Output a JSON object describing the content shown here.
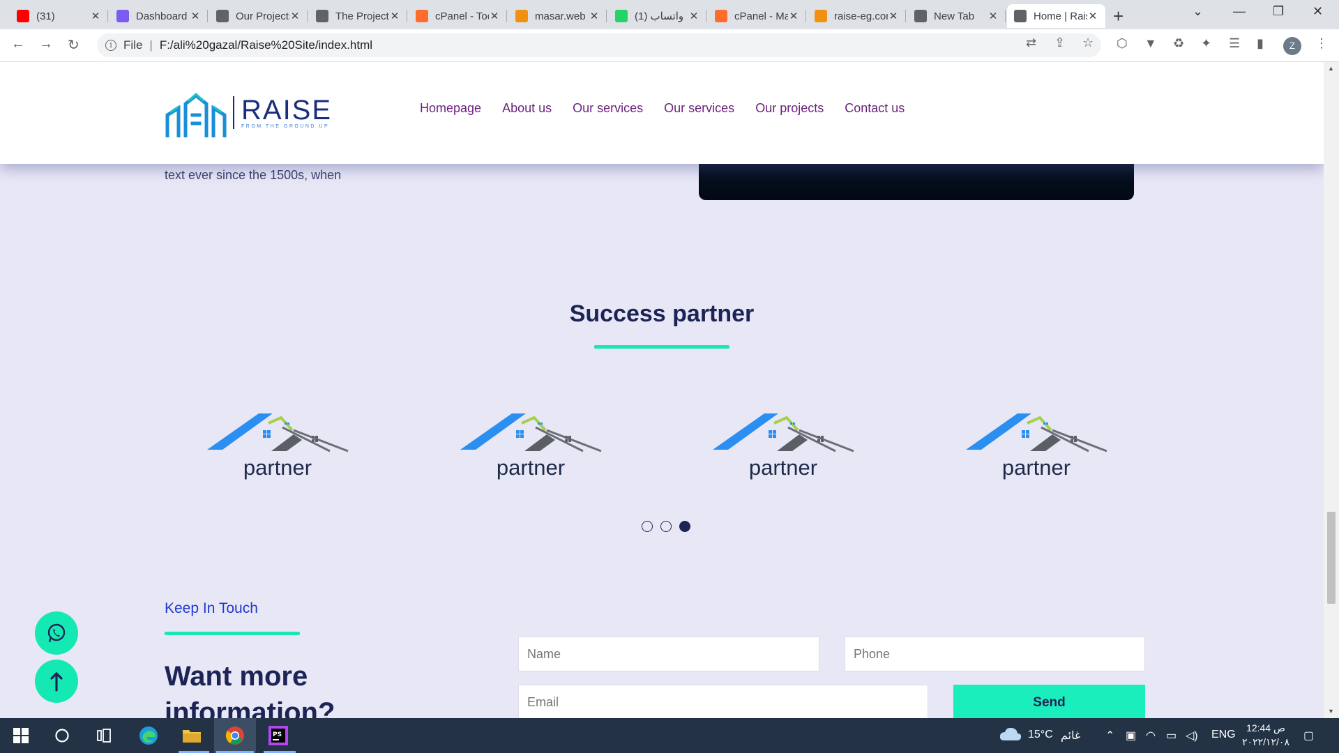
{
  "browser": {
    "tabs": [
      {
        "title": "(31)",
        "favicon": "youtube-icon",
        "color": "#ff0000"
      },
      {
        "title": "Dashboard",
        "favicon": "heart-logo-icon",
        "color": "#7b5cf0"
      },
      {
        "title": "Our Projects",
        "favicon": "globe-icon",
        "color": "#5f6368"
      },
      {
        "title": "The Projects",
        "favicon": "globe-icon",
        "color": "#5f6368"
      },
      {
        "title": "cPanel - Tools",
        "favicon": "cpanel-icon",
        "color": "#ff6c2c"
      },
      {
        "title": "masar.web",
        "favicon": "phpmyadmin-icon",
        "color": "#f29111"
      },
      {
        "title": "(1) واتساب",
        "favicon": "whatsapp-badge-icon",
        "color": "#25d366"
      },
      {
        "title": "cPanel - Main",
        "favicon": "cpanel-icon",
        "color": "#ff6c2c"
      },
      {
        "title": "raise-eg.com",
        "favicon": "phpmyadmin-icon",
        "color": "#f29111"
      },
      {
        "title": "New Tab",
        "favicon": "chrome-icon",
        "color": "#5f6368"
      },
      {
        "title": "Home | Raise",
        "favicon": "globe-icon",
        "color": "#5f6368",
        "active": true
      }
    ],
    "address": {
      "scheme": "File",
      "url": "F:/ali%20gazal/Raise%20Site/index.html"
    },
    "profile_initial": "Z"
  },
  "site": {
    "brand": {
      "name": "RAISE",
      "tagline": "FROM THE GROUND UP"
    },
    "nav": [
      "Homepage",
      "About us",
      "Our services",
      "Our services",
      "Our projects",
      "Contact us"
    ],
    "previous_text": "text ever since the 1500s, when",
    "partners_section": {
      "title": "Success partner",
      "partners": [
        "partner",
        "partner",
        "partner",
        "partner"
      ],
      "carousel": {
        "pages": 3,
        "active_page": 3
      }
    },
    "contact": {
      "label": "Keep In Touch",
      "heading": "Want more information?",
      "form": {
        "name_placeholder": "Name",
        "phone_placeholder": "Phone",
        "email_placeholder": "Email",
        "send_label": "Send"
      }
    },
    "accent_color": "#14e9b3",
    "text_color": "#1c2455"
  },
  "taskbar": {
    "weather": {
      "temp": "15°C",
      "condition": "غائم"
    },
    "language": "ENG",
    "time": "12:44 ص",
    "date": "٢٠٢٢/١٢/٠٨"
  }
}
